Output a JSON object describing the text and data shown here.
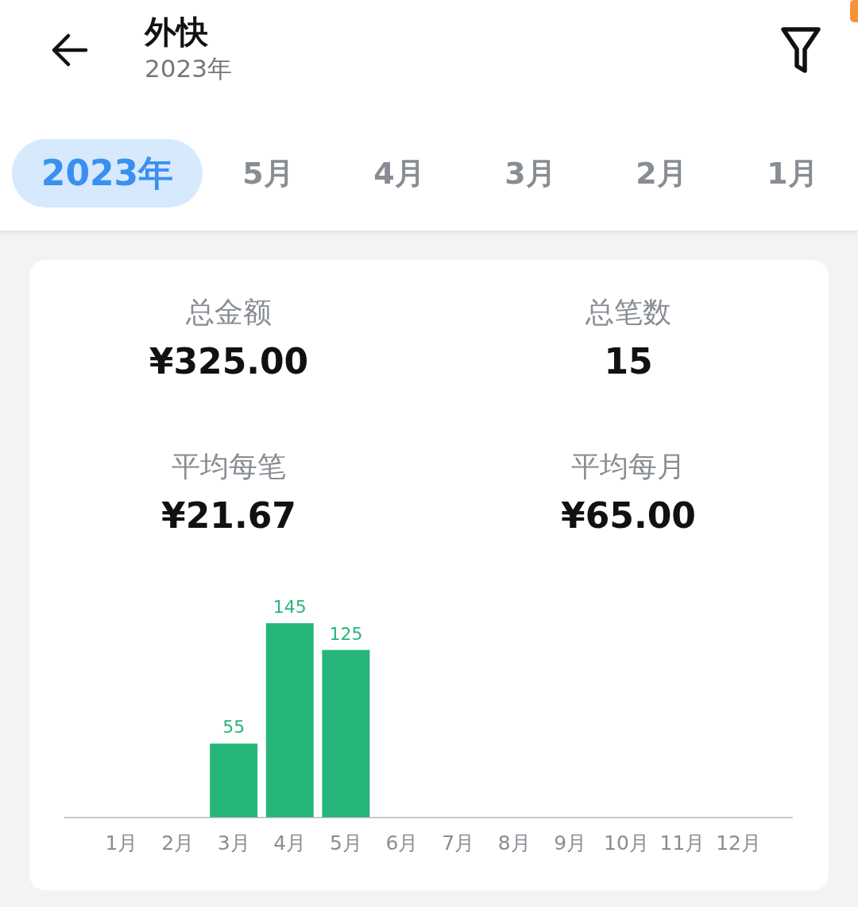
{
  "header": {
    "title": "外快",
    "subtitle": "2023年"
  },
  "tabs": [
    {
      "label": "2023年",
      "selected": true
    },
    {
      "label": "5月",
      "selected": false
    },
    {
      "label": "4月",
      "selected": false
    },
    {
      "label": "3月",
      "selected": false
    },
    {
      "label": "2月",
      "selected": false
    },
    {
      "label": "1月",
      "selected": false
    }
  ],
  "stats": [
    {
      "label": "总金额",
      "value": "¥325.00"
    },
    {
      "label": "总笔数",
      "value": "15"
    },
    {
      "label": "平均每笔",
      "value": "¥21.67"
    },
    {
      "label": "平均每月",
      "value": "¥65.00"
    }
  ],
  "chart_data": {
    "type": "bar",
    "categories": [
      "1月",
      "2月",
      "3月",
      "4月",
      "5月",
      "6月",
      "7月",
      "8月",
      "9月",
      "10月",
      "11月",
      "12月"
    ],
    "series": [
      {
        "color": "#27b679",
        "values": [
          null,
          null,
          55,
          145,
          125,
          null,
          null,
          null,
          null,
          null,
          null,
          null
        ]
      }
    ],
    "data_labels": true
  }
}
